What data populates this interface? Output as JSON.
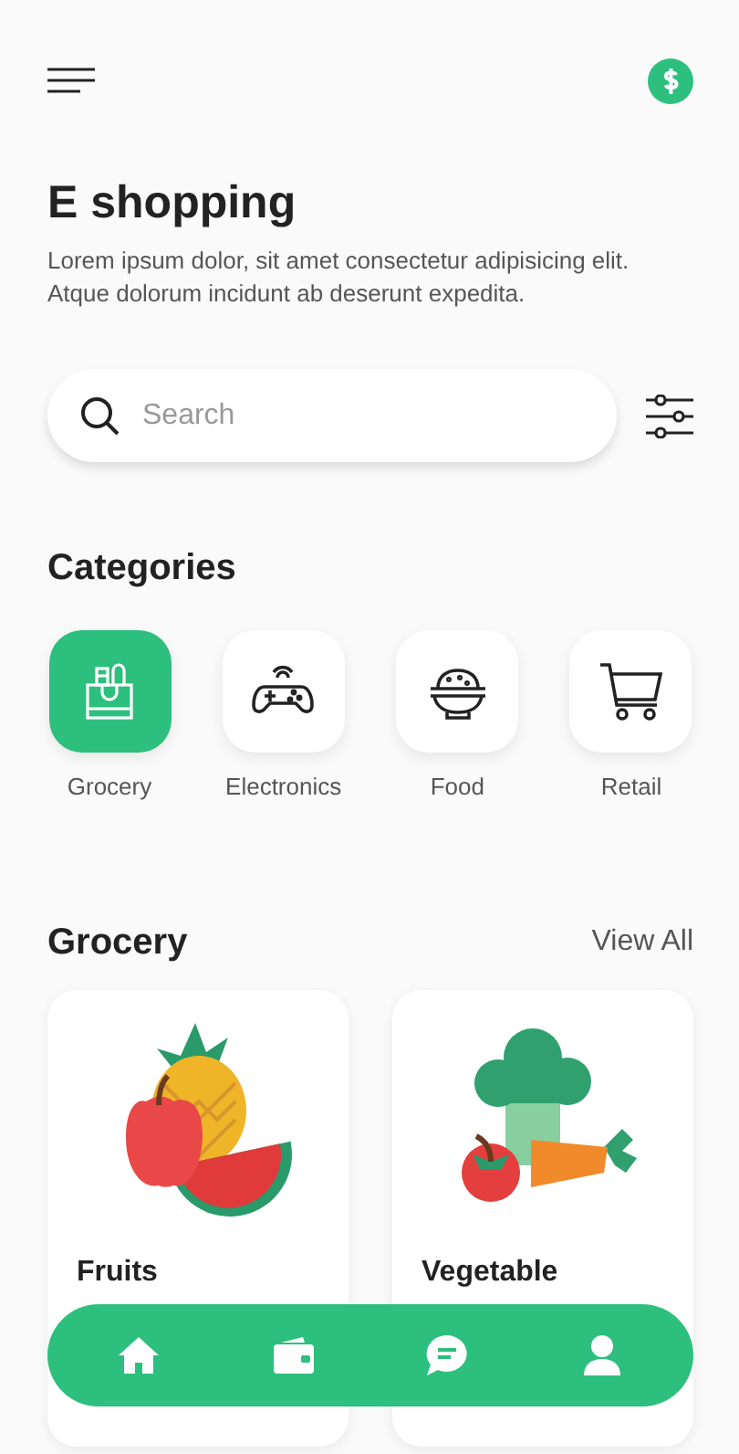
{
  "header": {
    "title": "E shopping",
    "description": "Lorem ipsum dolor, sit amet consectetur adipisicing elit. Atque dolorum incidunt ab deserunt expedita."
  },
  "search": {
    "placeholder": "Search"
  },
  "categories": {
    "title": "Categories",
    "items": [
      {
        "label": "Grocery",
        "selected": true
      },
      {
        "label": "Electronics",
        "selected": false
      },
      {
        "label": "Food",
        "selected": false
      },
      {
        "label": "Retail",
        "selected": false
      }
    ]
  },
  "section": {
    "title": "Grocery",
    "link": "View All"
  },
  "products": [
    {
      "name": "Fruits"
    },
    {
      "name": "Vegetable"
    }
  ]
}
